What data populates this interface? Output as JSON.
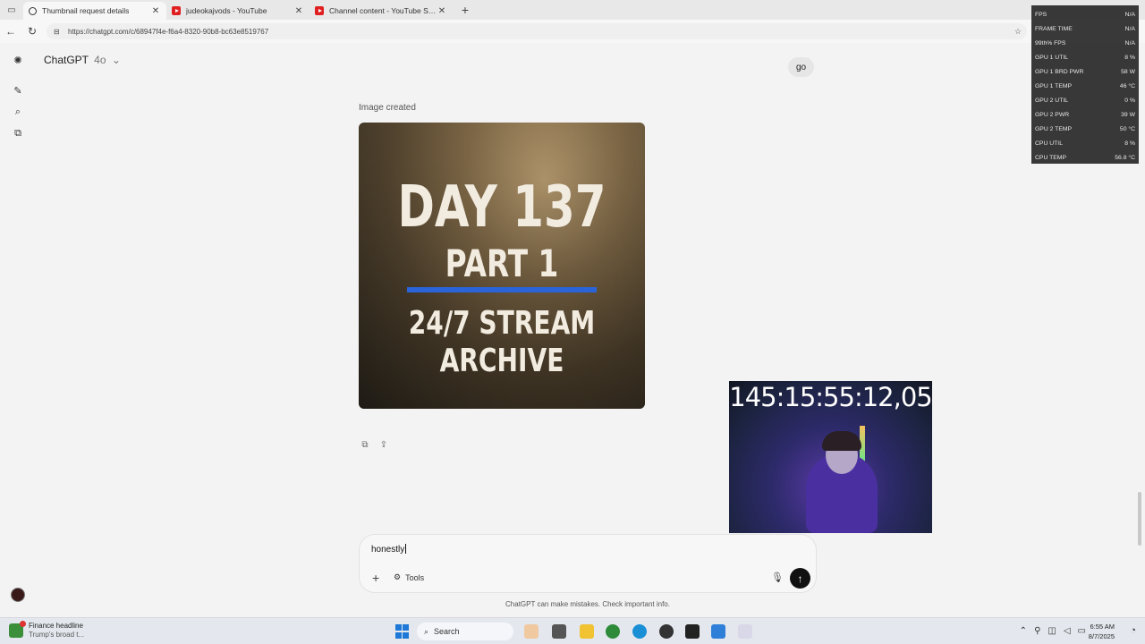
{
  "browser": {
    "tabs": [
      {
        "title": "Thumbnail request details",
        "icon": "chatgpt-icon",
        "active": true
      },
      {
        "title": "judeokajvods - YouTube",
        "icon": "youtube-icon",
        "active": false
      },
      {
        "title": "Channel content - YouTube Studio",
        "icon": "youtube-icon",
        "active": false
      }
    ],
    "url": "https://chatgpt.com/c/68947f4e-f6a4-8320-90b8-bc63e8519767"
  },
  "chat": {
    "model_name": "ChatGPT",
    "model_version": "4o",
    "user_message": "go",
    "image_caption": "Image created",
    "image_text": {
      "line1": "DAY 137",
      "line2": "PART 1",
      "line3": "24/7 STREAM",
      "line4": "ARCHIVE"
    },
    "composer": {
      "value": "honestly",
      "tools_label": "Tools"
    },
    "disclaimer": "ChatGPT can make mistakes. Check important info."
  },
  "webcam": {
    "timer": "145:15:55:12,05"
  },
  "perf_overlay": [
    {
      "label": "FPS",
      "value": "N/A"
    },
    {
      "label": "FRAME TIME",
      "value": "N/A"
    },
    {
      "label": "99th% FPS",
      "value": "N/A"
    },
    {
      "label": "GPU 1 UTIL",
      "value": "8 %"
    },
    {
      "label": "GPU 1 BRD PWR",
      "value": "58 W"
    },
    {
      "label": "GPU 1 TEMP",
      "value": "46 °C"
    },
    {
      "label": "GPU 2 UTIL",
      "value": "0 %"
    },
    {
      "label": "GPU 2 PWR",
      "value": "39 W"
    },
    {
      "label": "GPU 2 TEMP",
      "value": "50 °C"
    },
    {
      "label": "CPU UTIL",
      "value": "8 %"
    },
    {
      "label": "CPU TEMP",
      "value": "56.8 °C"
    }
  ],
  "taskbar": {
    "news_title": "Finance headline",
    "news_subtitle": "Trump's broad t...",
    "search_label": "Search",
    "time": "6:55 AM",
    "date": "8/7/2025"
  },
  "colors": {
    "accent_bar": "#2a64d8",
    "send_button": "#111111"
  }
}
